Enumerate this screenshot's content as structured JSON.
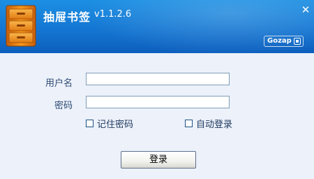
{
  "window": {
    "title": "抽屉书签",
    "version": "v1.1.2.6",
    "brand": "Gozap",
    "close_icon": "close-icon",
    "logo_icon": "drawer-cabinet-icon",
    "header_color": "#1476d2"
  },
  "login_form": {
    "username_label": "用户名",
    "username_value": "",
    "password_label": "密码",
    "password_value": "",
    "remember_password_label": "记住密码",
    "remember_password_checked": false,
    "auto_login_label": "自动登录",
    "auto_login_checked": false,
    "login_button_label": "登录"
  }
}
